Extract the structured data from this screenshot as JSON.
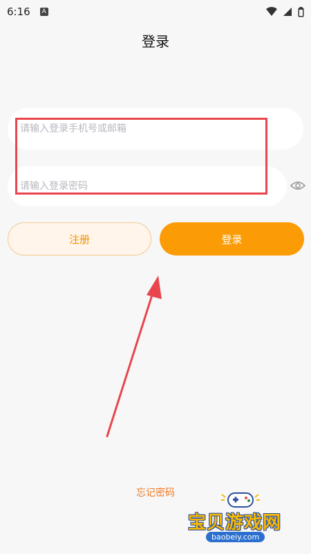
{
  "status_bar": {
    "time": "6:16",
    "notification_icon": "A"
  },
  "header": {
    "title": "登录"
  },
  "form": {
    "phone_placeholder": "请输入登录手机号或邮箱",
    "password_placeholder": "请输入登录密码"
  },
  "buttons": {
    "register_label": "注册",
    "login_label": "登录"
  },
  "links": {
    "forgot_password": "忘记密码"
  },
  "watermark": {
    "text": "宝贝游戏网",
    "url": "baobeiy.com"
  },
  "colors": {
    "accent": "#fb9c06",
    "link": "#f07a24",
    "annotation": "#e9454d"
  }
}
